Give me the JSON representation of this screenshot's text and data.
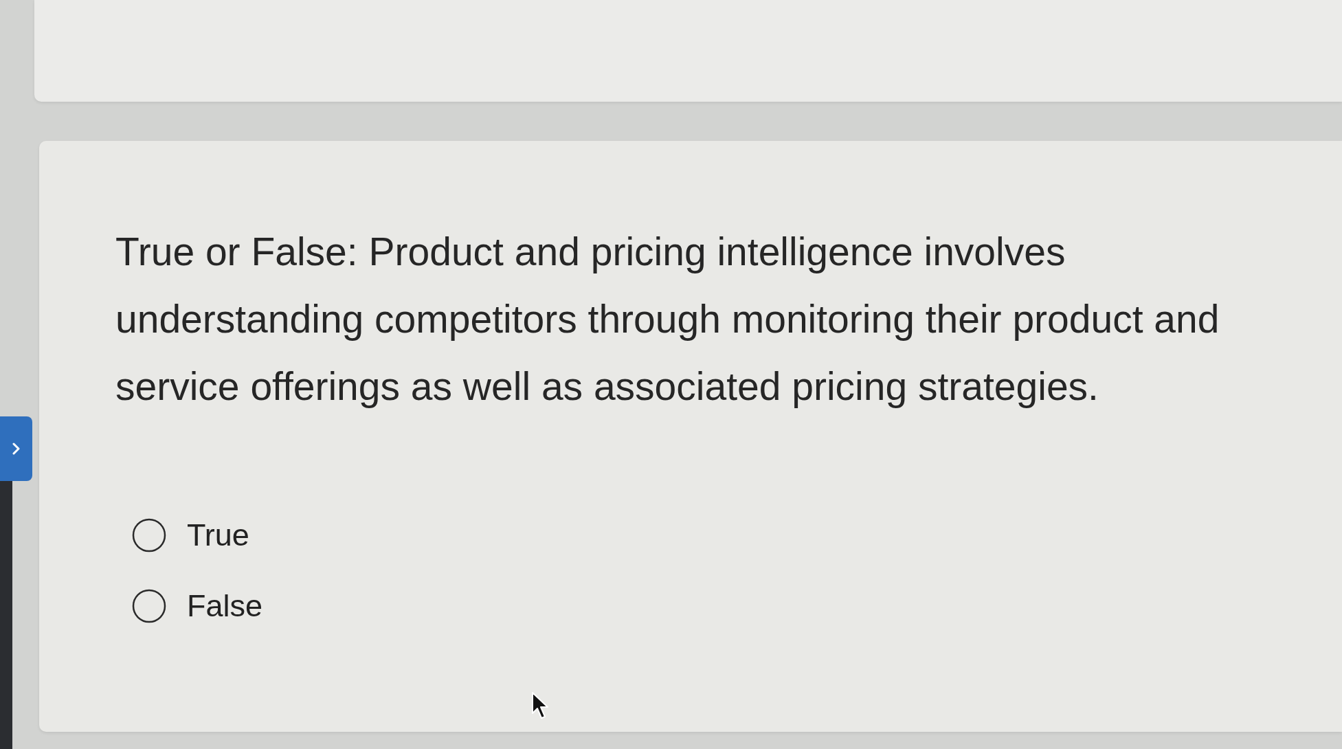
{
  "question": {
    "text": "True or False: Product and pricing intelligence involves understanding competitors through monitoring their product and service offerings as well as associated pricing strategies."
  },
  "options": [
    {
      "label": "True",
      "selected": false
    },
    {
      "label": "False",
      "selected": false
    }
  ]
}
